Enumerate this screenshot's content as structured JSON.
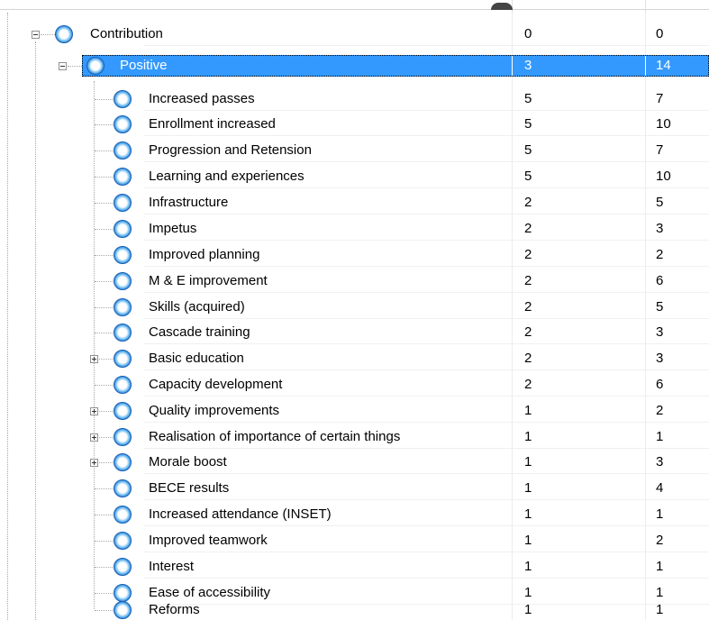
{
  "rows": [
    {
      "label": "Contribution",
      "col1": "0",
      "col2": "0"
    },
    {
      "label": "Positive",
      "col1": "3",
      "col2": "14"
    },
    {
      "label": "Increased passes",
      "col1": "5",
      "col2": "7"
    },
    {
      "label": "Enrollment increased",
      "col1": "5",
      "col2": "10"
    },
    {
      "label": "Progression and Retension",
      "col1": "5",
      "col2": "7"
    },
    {
      "label": "Learning and experiences",
      "col1": "5",
      "col2": "10"
    },
    {
      "label": "Infrastructure",
      "col1": "2",
      "col2": "5"
    },
    {
      "label": "Impetus",
      "col1": "2",
      "col2": "3"
    },
    {
      "label": "Improved planning",
      "col1": "2",
      "col2": "2"
    },
    {
      "label": "M & E improvement",
      "col1": "2",
      "col2": "6"
    },
    {
      "label": "Skills (acquired)",
      "col1": "2",
      "col2": "5"
    },
    {
      "label": "Cascade training",
      "col1": "2",
      "col2": "3"
    },
    {
      "label": "Basic education",
      "col1": "2",
      "col2": "3"
    },
    {
      "label": "Capacity development",
      "col1": "2",
      "col2": "6"
    },
    {
      "label": "Quality improvements",
      "col1": "1",
      "col2": "2"
    },
    {
      "label": "Realisation of importance of certain things",
      "col1": "1",
      "col2": "1"
    },
    {
      "label": "Morale boost",
      "col1": "1",
      "col2": "3"
    },
    {
      "label": "BECE results",
      "col1": "1",
      "col2": "4"
    },
    {
      "label": "Increased attendance (INSET)",
      "col1": "1",
      "col2": "1"
    },
    {
      "label": "Improved teamwork",
      "col1": "1",
      "col2": "2"
    },
    {
      "label": "Interest",
      "col1": "1",
      "col2": "1"
    },
    {
      "label": "Ease of accessibility",
      "col1": "1",
      "col2": "1"
    },
    {
      "label": "Reforms",
      "col1": "1",
      "col2": "1"
    }
  ],
  "colors": {
    "selection": "#3399ff",
    "node_icon": "#1669c9"
  },
  "icons": {
    "node": "node-orb-icon",
    "collapse": "collapse-icon",
    "expand": "expand-icon"
  }
}
